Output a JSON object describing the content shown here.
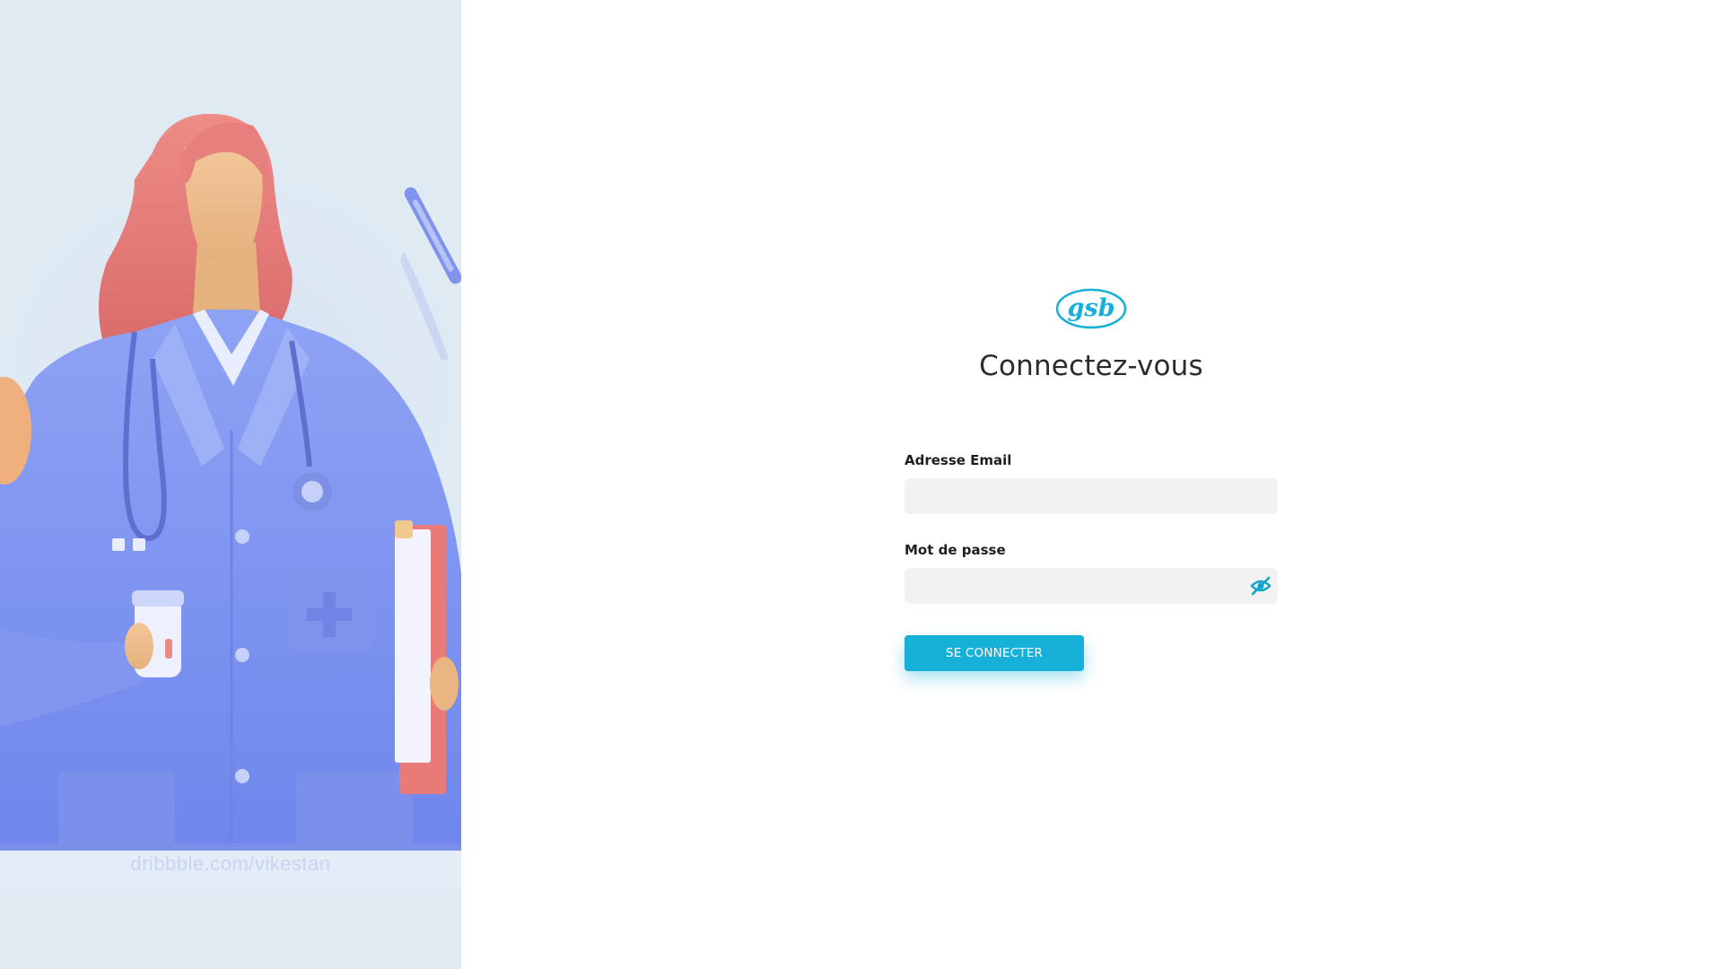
{
  "brand": {
    "logo_text": "gsb",
    "accent_color": "#16b0d8"
  },
  "illustration": {
    "watermark": "dribbble.com/vikestan"
  },
  "login": {
    "title": "Connectez-vous",
    "email": {
      "label": "Adresse Email",
      "value": "",
      "placeholder": ""
    },
    "password": {
      "label": "Mot de passe",
      "value": "",
      "placeholder": "",
      "toggle_icon": "eye-off-icon"
    },
    "submit_label": "SE CONNECTER"
  }
}
